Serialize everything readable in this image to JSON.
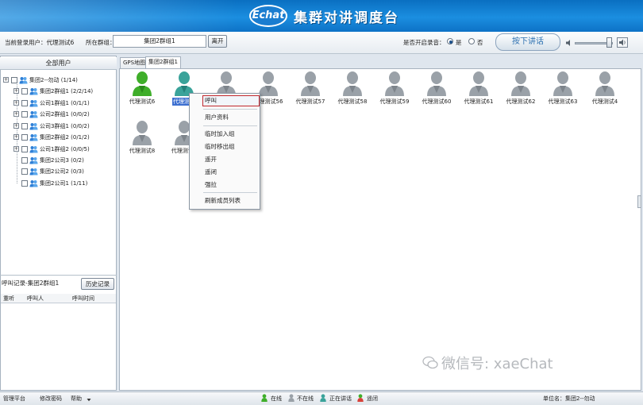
{
  "header": {
    "logo_text": "Echat",
    "title": "集群对讲调度台"
  },
  "toolbar": {
    "current_user": "当前登录用户：代理测试6",
    "group_label": "所在群组：",
    "group_value": "集团2群组1",
    "leave_button": "离开",
    "record_label": "是否开启录音：",
    "record_yes": "是",
    "record_no": "否",
    "record_selected": "是",
    "ptt_button": "按下讲话"
  },
  "left": {
    "all_users": "全部用户",
    "tree": [
      {
        "label": "集团2--勿动 (1/14)",
        "level": 0
      },
      {
        "label": "集团2群组1 (2/2/14)",
        "level": 1
      },
      {
        "label": "公司1群组1 (0/1/1)",
        "level": 1
      },
      {
        "label": "公司2群组1 (0/0/2)",
        "level": 1
      },
      {
        "label": "公司3群组1 (0/0/2)",
        "level": 1
      },
      {
        "label": "集团2群组2 (0/1/2)",
        "level": 1
      },
      {
        "label": "公司1群组2 (0/0/5)",
        "level": 1
      },
      {
        "label": "集团2公司3 (0/2)",
        "level": 2
      },
      {
        "label": "集团2公司2 (0/3)",
        "level": 2
      },
      {
        "label": "集团2公司1 (1/11)",
        "level": 2
      }
    ],
    "history_label": "呼叫记录-集团2群组1",
    "history_button": "历史记录",
    "history_columns": [
      "重听",
      "呼叫人",
      "呼叫时间"
    ]
  },
  "tabs": [
    "GPS地图",
    "集团2群组1"
  ],
  "users": [
    {
      "name": "代理测试6",
      "status": "online"
    },
    {
      "name": "代理测试",
      "status": "talking"
    },
    {
      "name": "",
      "status": "offline"
    },
    {
      "name": "代理测试56",
      "status": "offline"
    },
    {
      "name": "代理测试57",
      "status": "offline"
    },
    {
      "name": "代理测试58",
      "status": "offline"
    },
    {
      "name": "代理测试59",
      "status": "offline"
    },
    {
      "name": "代理测试60",
      "status": "offline"
    },
    {
      "name": "代理测试61",
      "status": "offline"
    },
    {
      "name": "代理测试62",
      "status": "offline"
    },
    {
      "name": "代理测试63",
      "status": "offline"
    },
    {
      "name": "代理测试4",
      "status": "offline"
    },
    {
      "name": "代理测试8",
      "status": "offline"
    },
    {
      "name": "代理测试9",
      "status": "offline"
    }
  ],
  "context_menu": [
    "呼叫",
    "用户资料",
    "临时加入组",
    "临时移出组",
    "遥开",
    "遥闭",
    "强拉",
    "刷新成员列表"
  ],
  "statusbar": {
    "manage": "管理平台",
    "change_pw": "修改密码",
    "help": "帮助",
    "legend_online": "在线",
    "legend_offline": "不在线",
    "legend_talking": "正在讲话",
    "legend_closed": "遥闭",
    "unit": "单位名：集团2--勿动"
  },
  "watermark": "微信号: xaeChat",
  "colors": {
    "header_blue": "#1b8ee0",
    "online_green": "#3fae2a",
    "talking_teal": "#3aa39a",
    "offline_gray": "#9aa1a8",
    "menu_highlight": "#c0262c"
  }
}
